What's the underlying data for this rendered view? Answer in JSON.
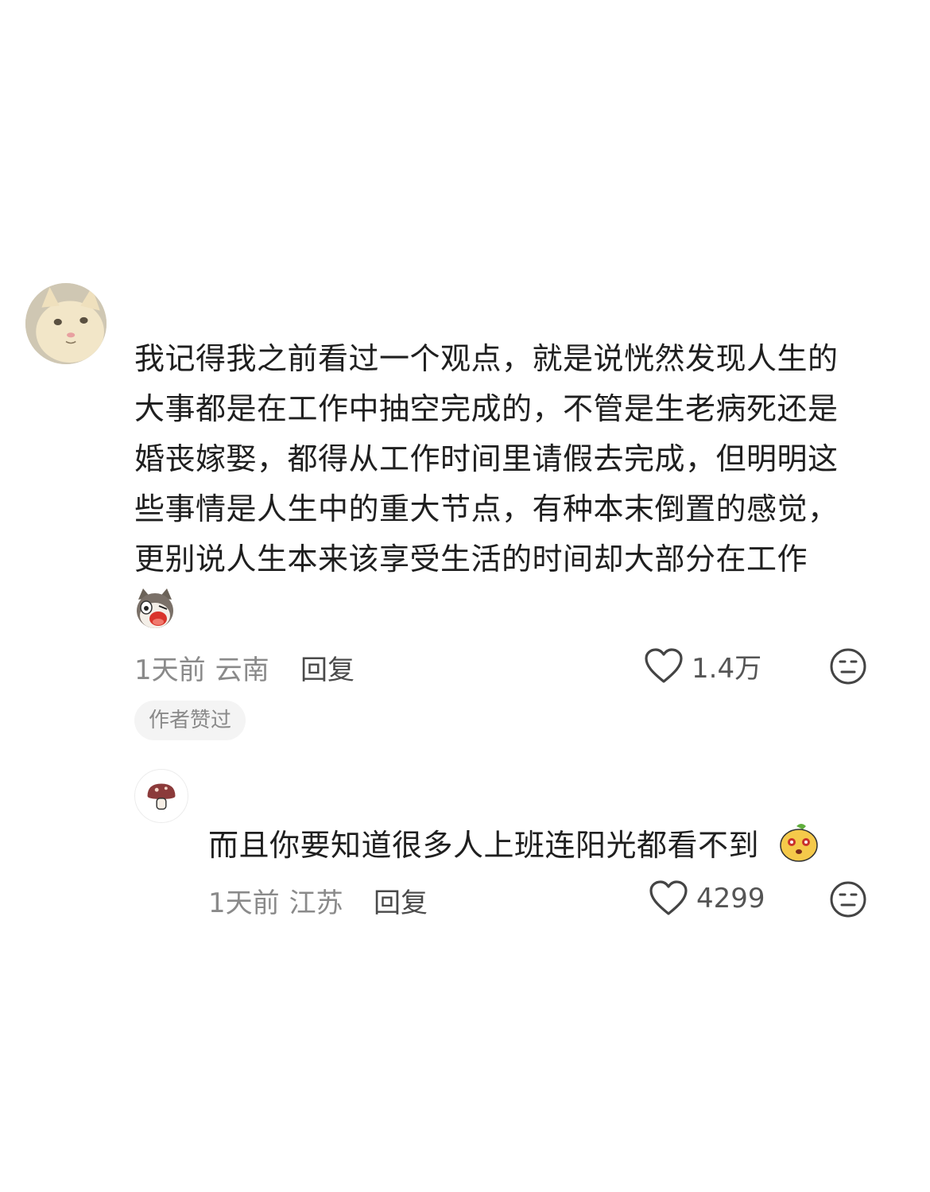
{
  "comments": [
    {
      "avatar": "cat-avatar",
      "text_lines": [
        "我记得我之前看过一个观点，就是说恍然发现人生的",
        "大事都是在工作中抽空完成的，不管是生老病死还是",
        "婚丧嫁娶，都得从工作时间里请假去完成，但明明这",
        "些事情是人生中的重大节点，有种本末倒置的感觉，",
        "更别说人生本来该享受生活的时间却大部分在工作"
      ],
      "sticker": "cat-crying-sticker",
      "time": "1天前",
      "location": "云南",
      "reply_label": "回复",
      "likes": "1.4万",
      "badge": "作者赞过"
    }
  ],
  "replies": [
    {
      "avatar": "mushroom-avatar",
      "text": "而且你要知道很多人上班连阳光都看不到",
      "sticker": "blob-emoji-sticker",
      "time": "1天前",
      "location": "江苏",
      "reply_label": "回复",
      "likes": "4299"
    }
  ],
  "colors": {
    "text": "#1f1f1f",
    "meta": "#8a8a8a",
    "badge_bg": "#f4f4f4"
  }
}
